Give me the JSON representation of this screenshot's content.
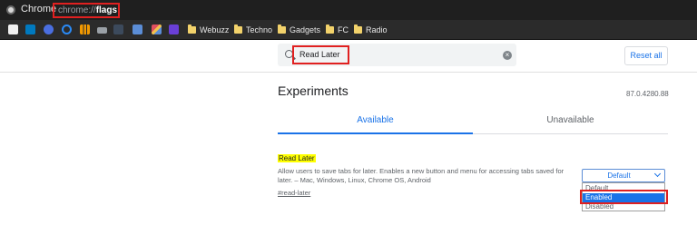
{
  "titlebar": {
    "app_name": "Chrome",
    "url_scheme": "chrome://",
    "url_host": "flags"
  },
  "bookmarks": {
    "folders": [
      "Webuzz",
      "Techno",
      "Gadgets",
      "FC",
      "Radio"
    ],
    "icons": [
      "page-icon",
      "trello-icon",
      "app-icon",
      "refresh-icon",
      "chart-icon",
      "car-icon",
      "box-icon",
      "calendar-icon",
      "rocket-icon",
      "sigma-icon"
    ]
  },
  "search": {
    "value": "Read Later",
    "clear_glyph": "×"
  },
  "reset_button": "Reset all",
  "main": {
    "title": "Experiments",
    "version": "87.0.4280.88",
    "tabs": [
      "Available",
      "Unavailable"
    ]
  },
  "flag": {
    "name": "Read Later",
    "description": "Allow users to save tabs for later. Enables a new button and menu for accessing tabs saved for later. – Mac, Windows, Linux, Chrome OS, Android",
    "link": "#read-later",
    "selected": "Default",
    "options": [
      "Default",
      "Enabled",
      "Disabled"
    ]
  },
  "colors": {
    "accent": "#1a73e8",
    "highlight": "#ffff00",
    "annotation": "#e02020",
    "titlebar": "#1f1f1f"
  }
}
